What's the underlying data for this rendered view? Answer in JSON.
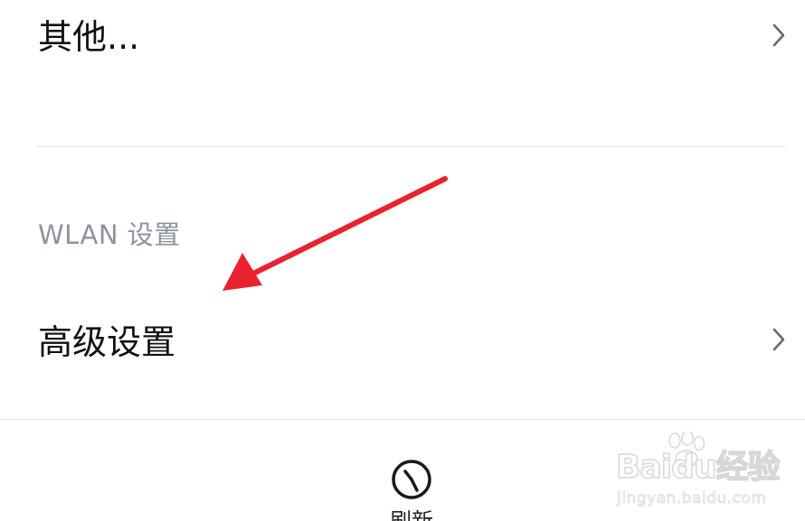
{
  "rows": {
    "other": {
      "title": "其他..."
    },
    "advanced": {
      "title": "高级设置"
    }
  },
  "section": {
    "wlan_settings": "WLAN 设置"
  },
  "bottom_bar": {
    "refresh_label": "刷新"
  },
  "watermark": {
    "brand": "Baidu经验",
    "url": "jingyan.baidu.com"
  },
  "colors": {
    "annotation_arrow": "#e8222e",
    "section_header": "#8e93a0",
    "chevron": "#6a6a6a",
    "divider": "#e2e2e2"
  },
  "icons": {
    "chevron": "chevron-right-icon",
    "refresh": "refresh-icon",
    "watermark_logo": "paw-icon"
  }
}
